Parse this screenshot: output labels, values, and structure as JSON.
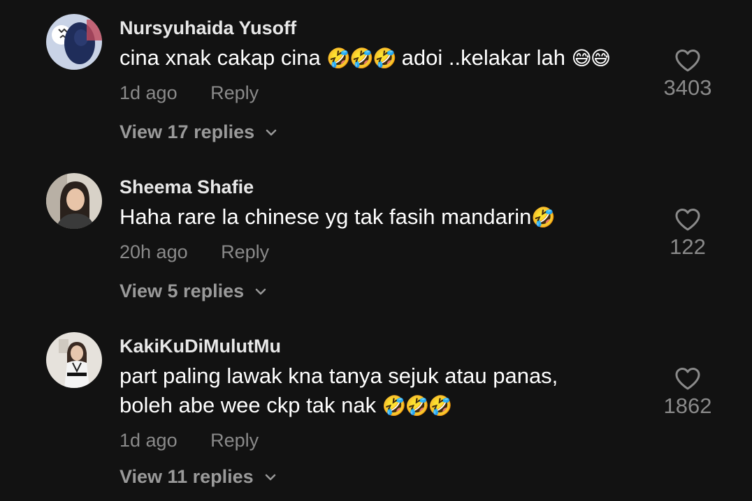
{
  "comments": [
    {
      "username": "Nursyuhaida Yusoff",
      "text": "cina xnak cakap cina",
      "emoji1": "🤣🤣🤣",
      "text2": "adoi ..kelakar lah",
      "emoji2": "😅😅",
      "time": "1d ago",
      "reply": "Reply",
      "view_replies": "View 17 replies",
      "likes": "3403",
      "avatar_desc": "person in hijab"
    },
    {
      "username": "Sheema Shafie",
      "text": "Haha rare la chinese yg tak fasih mandarin",
      "emoji1": "🤣",
      "time": "20h ago",
      "reply": "Reply",
      "view_replies": "View 5 replies",
      "likes": "122"
    },
    {
      "username": "KakiKuDiMulutMu",
      "text_line1": "part paling lawak kna tanya sejuk atau panas,",
      "text_line2": "boleh abe wee ckp tak nak",
      "emoji1": "🤣🤣🤣",
      "time": "1d ago",
      "reply": "Reply",
      "view_replies": "View 11 replies",
      "likes": "1862"
    }
  ]
}
